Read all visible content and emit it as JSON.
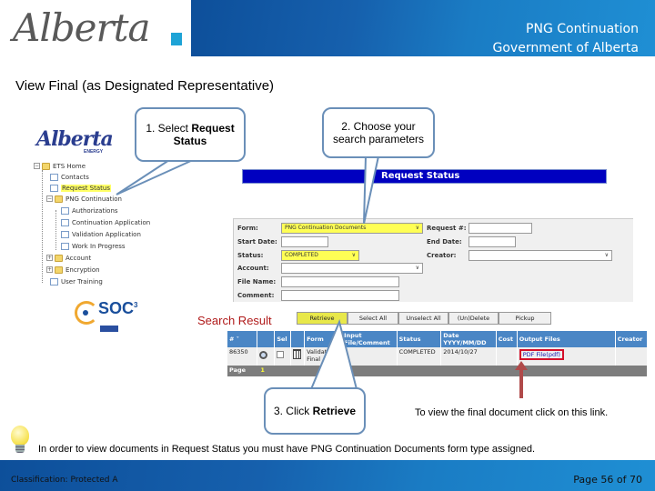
{
  "header": {
    "logo_text": "Alberta",
    "title_line1": "PNG Continuation",
    "title_line2": "Government of Alberta"
  },
  "page_title": "View Final (as Designated Representative)",
  "left_nav": {
    "logo_text": "Alberta",
    "logo_subtext": "ENERGY",
    "tree": [
      {
        "label": "ETS Home",
        "type": "folder",
        "expander": "minus",
        "level": 0
      },
      {
        "label": "Contacts",
        "type": "page",
        "level": 1
      },
      {
        "label": "Request Status",
        "type": "page",
        "level": 1,
        "highlighted": true
      },
      {
        "label": "PNG Continuation",
        "type": "folder",
        "expander": "minus",
        "level": 1
      },
      {
        "label": "Authorizations",
        "type": "page",
        "level": 2
      },
      {
        "label": "Continuation Application",
        "type": "page",
        "level": 2
      },
      {
        "label": "Validation Application",
        "type": "page",
        "level": 2
      },
      {
        "label": "Work In Progress",
        "type": "page",
        "level": 2
      },
      {
        "label": "Account",
        "type": "folder",
        "expander": "plus",
        "level": 1
      },
      {
        "label": "Encryption",
        "type": "folder",
        "expander": "plus",
        "level": 1
      },
      {
        "label": "User Training",
        "type": "page",
        "level": 1
      }
    ],
    "soc_logo_text": "SOC",
    "soc_superscript": "3"
  },
  "callouts": {
    "step1_prefix": "1. Select ",
    "step1_bold": "Request Status",
    "step2": "2. Choose your search parameters",
    "step3_prefix": "3. Click ",
    "step3_bold": "Retrieve"
  },
  "request_status": {
    "title": "Request Status",
    "fields": {
      "form_label": "Form:",
      "form_value": "PNG Continuation Documents",
      "start_date_label": "Start Date:",
      "start_date_value": "",
      "status_label": "Status:",
      "status_value": "COMPLETED",
      "account_label": "Account:",
      "account_value": "",
      "file_name_label": "File Name:",
      "file_name_value": "",
      "comment_label": "Comment:",
      "comment_value": "",
      "request_no_label": "Request #:",
      "request_no_value": "",
      "end_date_label": "End Date:",
      "end_date_value": "",
      "creator_label": "Creator:",
      "creator_value": ""
    }
  },
  "search_result": {
    "label": "Search Result",
    "buttons": [
      "Retrieve",
      "Select All",
      "Unselect All",
      "(Un)Delete",
      "Pickup"
    ],
    "columns": [
      "# ˅",
      "",
      "Sel",
      "",
      "Form",
      "Input File/Comment",
      "Status",
      "Date YYYY/MM/DD",
      "Cost",
      "Output Files",
      "Creator"
    ],
    "rows": [
      {
        "id": "86350",
        "form": "Validation Final",
        "input_file": "",
        "status": "COMPLETED",
        "date": "2014/10/27",
        "cost": "",
        "output_file": "PDF File(pdf)",
        "creator": ""
      }
    ],
    "pager_label": "Page",
    "pager_current": "1"
  },
  "link_note": "To view the final document click on this link.",
  "tip": "In order to view documents in Request Status you must have PNG Continuation Documents form type assigned.",
  "footer": {
    "classification": "Classification: Protected A",
    "page": "Page 56 of 70"
  },
  "colors": {
    "header_blue": "#1660ad",
    "accent_cyan": "#1ea3d6",
    "panel_bar": "#0000c0",
    "table_header": "#4a86c5",
    "highlight_yellow": "#ffff55",
    "link_box_red": "#d4102a",
    "search_result_red": "#b01a1a"
  }
}
